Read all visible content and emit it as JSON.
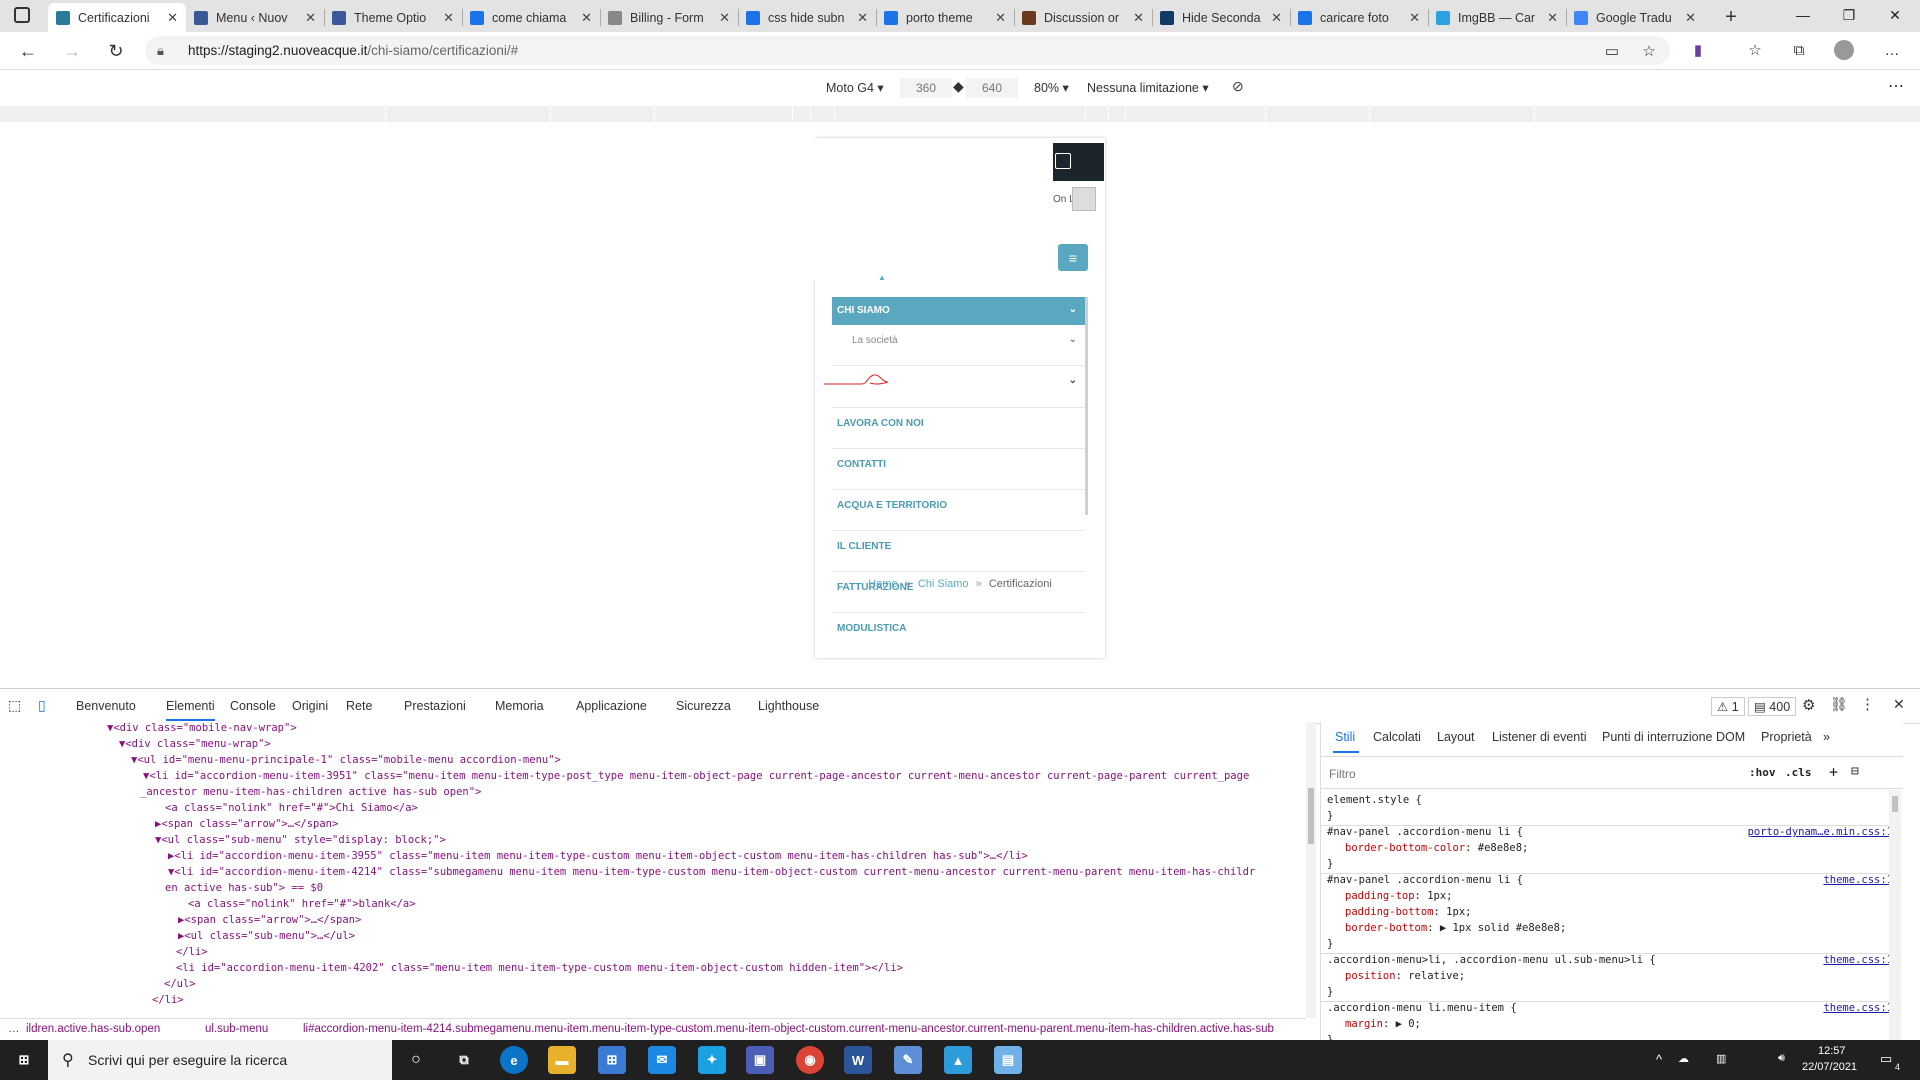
{
  "browser": {
    "tabs": [
      {
        "title": "Certificazioni",
        "icon_color": "#2a7a9b",
        "active": true
      },
      {
        "title": "Menu ‹ Nuov",
        "icon_color": "#3b5998"
      },
      {
        "title": "Theme Optio",
        "icon_color": "#3b5998"
      },
      {
        "title": "come chiama",
        "icon_color": "#1a73e8"
      },
      {
        "title": "Billing - Form",
        "icon_color": "#888888"
      },
      {
        "title": "css hide subn",
        "icon_color": "#1a73e8"
      },
      {
        "title": "porto theme",
        "icon_color": "#1a73e8"
      },
      {
        "title": "Discussion or",
        "icon_color": "#6b3a1e"
      },
      {
        "title": "Hide Seconda",
        "icon_color": "#0f3b64"
      },
      {
        "title": "caricare foto",
        "icon_color": "#1a73e8"
      },
      {
        "title": "ImgBB — Car",
        "icon_color": "#2aa1e0"
      },
      {
        "title": "Google Tradu",
        "icon_color": "#4285f4"
      }
    ],
    "new_tab_label": "+",
    "url_host": "https://staging2.nuoveacque.it",
    "url_path": "/chi-siamo/certificazioni/#"
  },
  "device_toolbar": {
    "device": "Moto G4",
    "width": "360",
    "height": "640",
    "zoom": "80%",
    "throttle": "Nessuna limitazione"
  },
  "mobile_page": {
    "topbar_text": "On L",
    "menu_head": "CHI SIAMO",
    "submenu": [
      "La società",
      ""
    ],
    "menu_items": [
      "LAVORA CON NOI",
      "CONTATTI",
      "ACQUA E TERRITORIO",
      "IL CLIENTE",
      "FATTURAZIONE",
      "MODULISTICA"
    ],
    "breadcrumb": {
      "home": "Home",
      "sep": "»",
      "parent": "Chi Siamo",
      "current": "Certificazioni"
    }
  },
  "devtools": {
    "tabs": [
      "Benvenuto",
      "Elementi",
      "Console",
      "Origini",
      "Rete",
      "Prestazioni",
      "Memoria",
      "Applicazione",
      "Sicurezza",
      "Lighthouse"
    ],
    "active_tab": "Elementi",
    "warnings": "1",
    "messages": "400",
    "code_lines": [
      "▼<div class=\"mobile-nav-wrap\">",
      "▼<div class=\"menu-wrap\">",
      "▼<ul id=\"menu-menu-principale-1\" class=\"mobile-menu accordion-menu\">",
      "▼<li id=\"accordion-menu-item-3951\" class=\"menu-item menu-item-type-post_type menu-item-object-page current-page-ancestor current-menu-ancestor current-page-parent current_page",
      "_ancestor menu-item-has-children active has-sub open\">",
      "<a class=\"nolink\" href=\"#\">Chi Siamo</a>",
      "▶<span class=\"arrow\">…</span>",
      "▼<ul class=\"sub-menu\" style=\"display: block;\">",
      "▶<li id=\"accordion-menu-item-3955\" class=\"menu-item menu-item-type-custom menu-item-object-custom menu-item-has-children has-sub\">…</li>",
      "▼<li id=\"accordion-menu-item-4214\" class=\"submegamenu menu-item menu-item-type-custom menu-item-object-custom current-menu-ancestor current-menu-parent menu-item-has-childr",
      "en active has-sub\"> == $0",
      "<a class=\"nolink\" href=\"#\">blank</a>",
      "▶<span class=\"arrow\">…</span>",
      "▶<ul class=\"sub-menu\">…</ul>",
      "</li>",
      "<li id=\"accordion-menu-item-4202\" class=\"menu-item menu-item-type-custom menu-item-object-custom hidden-item\"></li>",
      "</ul>",
      "</li>"
    ],
    "breadcrumb_bar": [
      "…",
      "ildren.active.has-sub.open",
      "ul.sub-menu",
      "li#accordion-menu-item-4214.submegamenu.menu-item.menu-item-type-custom.menu-item-object-custom.current-menu-ancestor.current-menu-parent.menu-item-has-children.active.has-sub",
      "…"
    ],
    "styles_tabs": [
      "Stili",
      "Calcolati",
      "Layout",
      "Listener di eventi",
      "Punti di interruzione DOM",
      "Proprietà",
      "»"
    ],
    "filter_placeholder": "Filtro",
    "hov": ":hov",
    "cls": ".cls",
    "rules": [
      {
        "selector": "element.style {",
        "props": [],
        "source": ""
      },
      {
        "selector": "#nav-panel .accordion-menu li {",
        "props": [
          [
            "border-bottom-color",
            "#e8e8e8;"
          ]
        ],
        "source": "porto-dynam…e.min.css:1"
      },
      {
        "selector": "#nav-panel .accordion-menu li {",
        "props": [
          [
            "padding-top",
            "1px;"
          ],
          [
            "padding-bottom",
            "1px;"
          ],
          [
            "border-bottom",
            "▶ 1px solid #e8e8e8;"
          ]
        ],
        "source": "theme.css:1"
      },
      {
        "selector": ".accordion-menu>li, .accordion-menu ul.sub-menu>li {",
        "props": [
          [
            "position",
            "relative;"
          ]
        ],
        "source": "theme.css:1"
      },
      {
        "selector": ".accordion-menu li.menu-item {",
        "props": [
          [
            "margin",
            "▶ 0;"
          ]
        ],
        "source": "theme.css:1"
      }
    ]
  },
  "taskbar": {
    "search_placeholder": "Scrivi qui per eseguire la ricerca",
    "time": "12:57",
    "date": "22/07/2021",
    "notifications": "4"
  }
}
